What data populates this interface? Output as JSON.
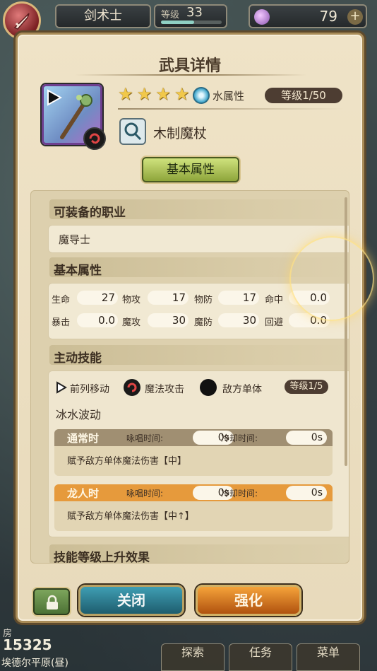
{
  "topbar": {
    "class_name": "剑术士",
    "level_label": "等级",
    "level_value": "33",
    "level_progress": 0.55,
    "gems": "79",
    "plus": "+"
  },
  "panel": {
    "title": "武具详情",
    "weapon": {
      "stars": [
        "★",
        "★",
        "★",
        "★"
      ],
      "element": "水属性",
      "level": "等级1/50",
      "name": "木制魔杖"
    },
    "tab_label": "基本属性",
    "equip_section": {
      "title": "可装备的职业",
      "job": "魔导士"
    },
    "stats_section": {
      "title": "基本属性",
      "rows": [
        [
          {
            "label": "生命",
            "value": "27"
          },
          {
            "label": "物攻",
            "value": "17"
          },
          {
            "label": "物防",
            "value": "17"
          },
          {
            "label": "命中",
            "value": "0.0"
          }
        ],
        [
          {
            "label": "暴击",
            "value": "0.0"
          },
          {
            "label": "魔攻",
            "value": "30"
          },
          {
            "label": "魔防",
            "value": "30"
          },
          {
            "label": "回避",
            "value": "0.0"
          }
        ]
      ]
    },
    "active_skill": {
      "title": "主动技能",
      "tags": [
        "前列移动",
        "魔法攻击",
        "敌方单体"
      ],
      "level": "等级1/5",
      "name": "冰水波动",
      "states": [
        {
          "name": "通常时",
          "cast_label": "咏唱时间:",
          "cast_value": "0s",
          "cooldown_label": "冷却时间:",
          "cooldown_value": "0s",
          "desc": "赋予敌方单体魔法伤害【中】",
          "color": "#a08f72"
        },
        {
          "name": "龙人时",
          "cast_label": "咏唱时间:",
          "cast_value": "0s",
          "cooldown_label": "冷却时间:",
          "cooldown_value": "0s",
          "desc": "赋予敌方单体魔法伤害【中↑】",
          "color": "#e69a3c"
        }
      ]
    },
    "upgrade_section_title": "技能等级上升效果",
    "buttons": {
      "close": "关闭",
      "enhance": "强化"
    }
  },
  "footer": {
    "location_label": "房",
    "gold": "15325",
    "place": "埃德尔平原(昼)",
    "tabs": [
      "探索",
      "任务",
      "菜单"
    ]
  }
}
